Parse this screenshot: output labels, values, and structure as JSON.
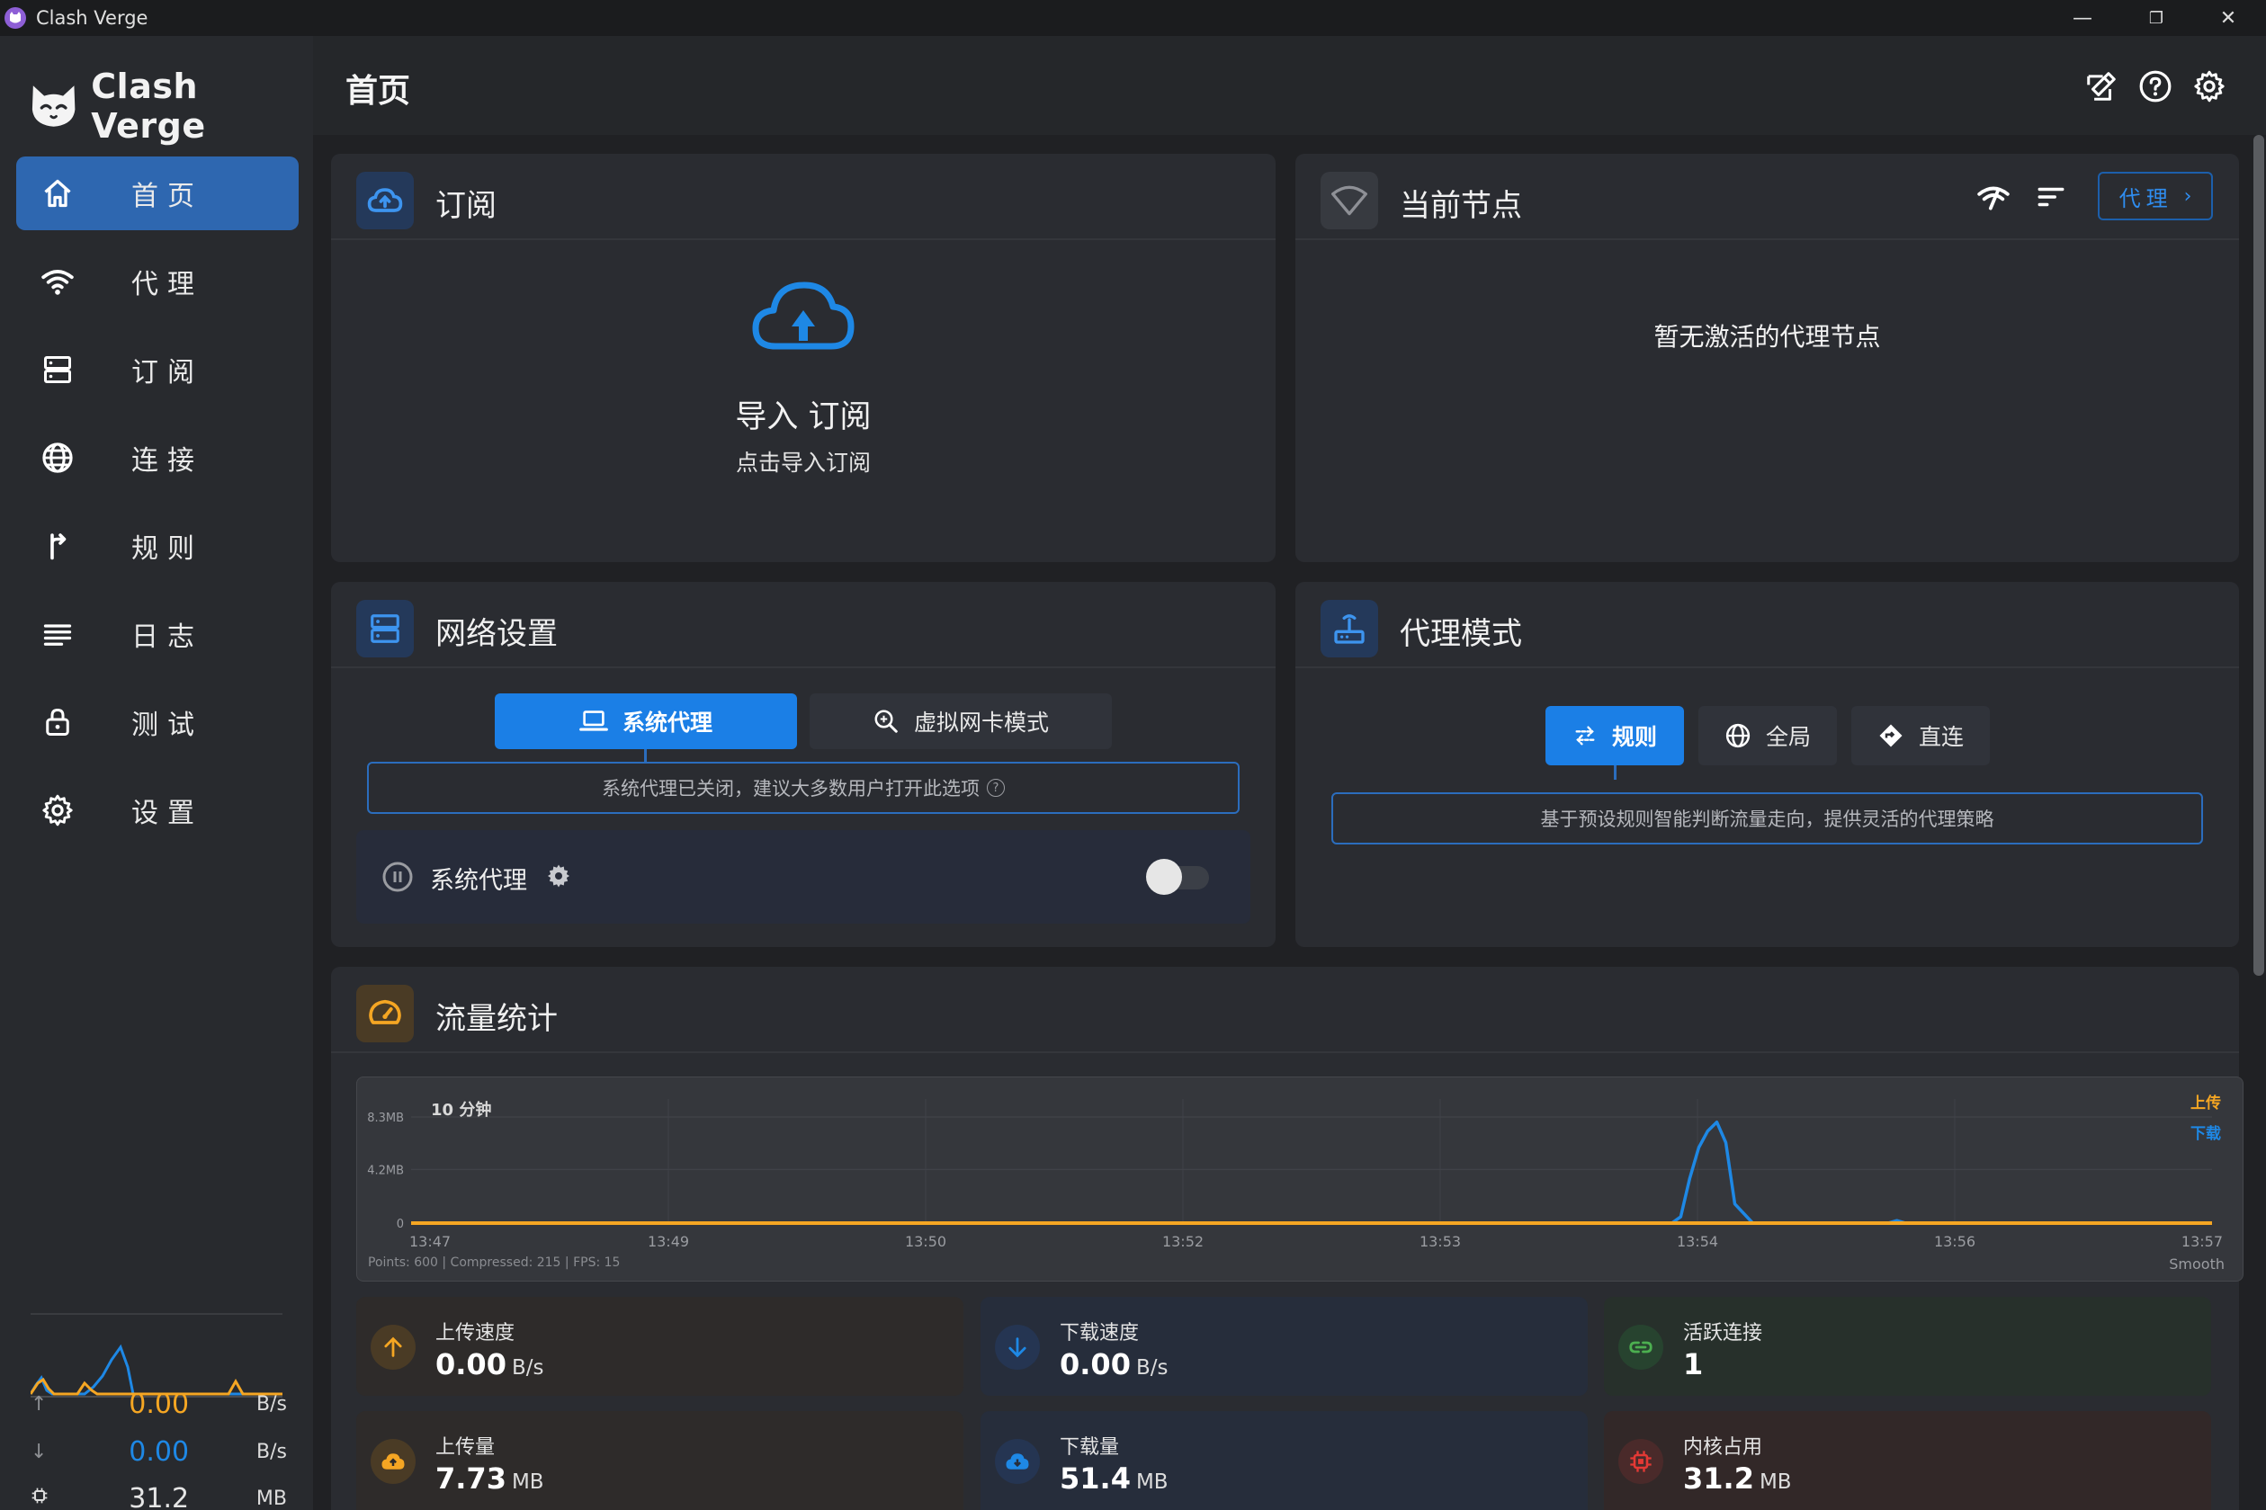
{
  "window": {
    "title": "Clash Verge",
    "minimize": "—",
    "restore": "❐",
    "close": "✕"
  },
  "brand": {
    "name": "Clash Verge"
  },
  "nav": [
    {
      "label": "首页",
      "icon": "home-icon",
      "active": true
    },
    {
      "label": "代理",
      "icon": "wifi-icon",
      "active": false
    },
    {
      "label": "订阅",
      "icon": "storage-icon",
      "active": false
    },
    {
      "label": "连接",
      "icon": "globe-icon",
      "active": false
    },
    {
      "label": "规则",
      "icon": "fork-icon",
      "active": false
    },
    {
      "label": "日志",
      "icon": "list-icon",
      "active": false
    },
    {
      "label": "测试",
      "icon": "lock-icon",
      "active": false
    },
    {
      "label": "设置",
      "icon": "gear-icon",
      "active": false
    }
  ],
  "mini_stats": {
    "up_value": "0.00",
    "up_unit": "B/s",
    "down_value": "0.00",
    "down_unit": "B/s",
    "mem_value": "31.2",
    "mem_unit": "MB"
  },
  "header": {
    "title": "首页"
  },
  "subscription": {
    "title": "订阅",
    "import_title": "导入 订阅",
    "import_hint": "点击导入订阅"
  },
  "current_node": {
    "title": "当前节点",
    "proxy_button": "代理",
    "empty_text": "暂无激活的代理节点"
  },
  "network": {
    "title": "网络设置",
    "tab_system": "系统代理",
    "tab_tun": "虚拟网卡模式",
    "hint": "系统代理已关闭，建议大多数用户打开此选项",
    "toggle_label": "系统代理",
    "toggle_on": false
  },
  "proxy_mode": {
    "title": "代理模式",
    "mode_rule": "规则",
    "mode_global": "全局",
    "mode_direct": "直连",
    "hint": "基于预设规则智能判断流量走向，提供灵活的代理策略"
  },
  "traffic": {
    "title": "流量统计",
    "range_label": "10 分钟",
    "legend_up": "上传",
    "legend_down": "下载",
    "footer": "Points: 600 | Compressed: 215 | FPS: 15",
    "smooth_label": "Smooth"
  },
  "colors": {
    "upload": "#f5a623",
    "download": "#1e88e5",
    "accent": "#1b7fe6"
  },
  "chart_data": {
    "type": "line",
    "ytick_labels": [
      "8.3MB",
      "4.2MB",
      "0"
    ],
    "y_ticks": [
      8.3,
      4.2,
      0
    ],
    "ylim": [
      0,
      8.3
    ],
    "x_tick_labels": [
      "13:47",
      "13:49",
      "13:50",
      "13:52",
      "13:53",
      "13:54",
      "13:56",
      "13:57"
    ],
    "x_range_minutes": [
      0,
      10
    ],
    "series": [
      {
        "name": "上传",
        "color": "#f5a623",
        "x_minutes": [
          0,
          10
        ],
        "y_mb": [
          0,
          0
        ]
      },
      {
        "name": "下载",
        "color": "#1e88e5",
        "x_minutes": [
          0,
          7.0,
          7.05,
          7.1,
          7.15,
          7.2,
          7.25,
          7.3,
          7.35,
          7.45,
          8.2,
          8.25,
          8.3,
          10
        ],
        "y_mb": [
          0,
          0,
          0.5,
          3.5,
          5.9,
          7.2,
          7.9,
          6.3,
          1.5,
          0,
          0,
          0.2,
          0,
          0
        ]
      }
    ]
  },
  "stats": [
    {
      "label": "上传速度",
      "value": "0.00",
      "unit": "B/s",
      "icon": "arrow-up-icon"
    },
    {
      "label": "下载速度",
      "value": "0.00",
      "unit": "B/s",
      "icon": "arrow-down-icon"
    },
    {
      "label": "活跃连接",
      "value": "1",
      "unit": "",
      "icon": "link-icon"
    },
    {
      "label": "上传量",
      "value": "7.73",
      "unit": "MB",
      "icon": "cloud-upload-icon"
    },
    {
      "label": "下载量",
      "value": "51.4",
      "unit": "MB",
      "icon": "cloud-download-icon"
    },
    {
      "label": "内核占用",
      "value": "31.2",
      "unit": "MB",
      "icon": "chip-icon"
    }
  ]
}
